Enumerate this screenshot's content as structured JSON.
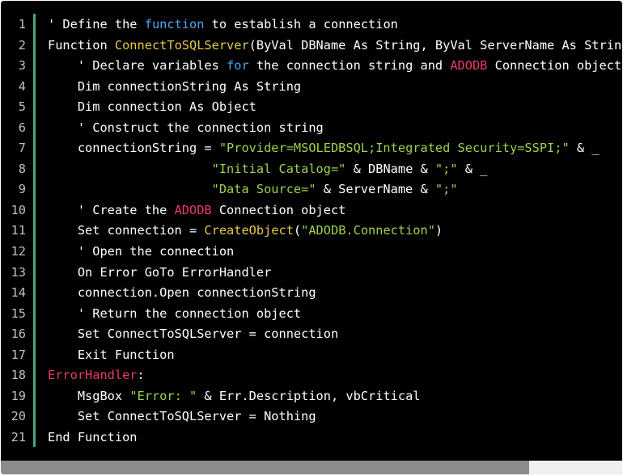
{
  "editor": {
    "language": "VBA",
    "colors": {
      "background": "#000000",
      "text": "#ffffff",
      "line_number": "#c0c0c0",
      "gutter_border": "#48a87b",
      "keyword": "#4aa5f0",
      "function_name": "#e6c84a",
      "string": "#9dd34c",
      "identifier": "#ee3a6a",
      "scroll_thumb": "#8c8c8c",
      "scroll_track": "#f0f0f0"
    },
    "lines": [
      {
        "number": "1",
        "tokens": [
          {
            "t": "plain",
            "v": "' Define the "
          },
          {
            "t": "kw",
            "v": "function"
          },
          {
            "t": "plain",
            "v": " to establish a connection"
          }
        ]
      },
      {
        "number": "2",
        "tokens": [
          {
            "t": "plain",
            "v": "Function "
          },
          {
            "t": "fn",
            "v": "ConnectToSQLServer"
          },
          {
            "t": "plain",
            "v": "(ByVal DBName As String, ByVal ServerName As String)"
          }
        ]
      },
      {
        "number": "3",
        "tokens": [
          {
            "t": "plain",
            "v": "    ' Declare variables "
          },
          {
            "t": "kw",
            "v": "for"
          },
          {
            "t": "plain",
            "v": " the connection string and "
          },
          {
            "t": "ident",
            "v": "ADODB"
          },
          {
            "t": "plain",
            "v": " Connection object"
          }
        ]
      },
      {
        "number": "4",
        "tokens": [
          {
            "t": "plain",
            "v": "    Dim connectionString As String"
          }
        ]
      },
      {
        "number": "5",
        "tokens": [
          {
            "t": "plain",
            "v": "    Dim connection As Object"
          }
        ]
      },
      {
        "number": "6",
        "tokens": [
          {
            "t": "plain",
            "v": "    ' Construct the connection string"
          }
        ]
      },
      {
        "number": "7",
        "tokens": [
          {
            "t": "plain",
            "v": "    connectionString = "
          },
          {
            "t": "str",
            "v": "\"Provider=MSOLEDBSQL;Integrated Security=SSPI;\""
          },
          {
            "t": "plain",
            "v": " & _"
          }
        ]
      },
      {
        "number": "8",
        "tokens": [
          {
            "t": "plain",
            "v": "                      "
          },
          {
            "t": "str",
            "v": "\"Initial Catalog=\""
          },
          {
            "t": "plain",
            "v": " & DBName & "
          },
          {
            "t": "str",
            "v": "\";\""
          },
          {
            "t": "plain",
            "v": " & _"
          }
        ]
      },
      {
        "number": "9",
        "tokens": [
          {
            "t": "plain",
            "v": "                      "
          },
          {
            "t": "str",
            "v": "\"Data Source=\""
          },
          {
            "t": "plain",
            "v": " & ServerName & "
          },
          {
            "t": "str",
            "v": "\";\""
          }
        ]
      },
      {
        "number": "10",
        "tokens": [
          {
            "t": "plain",
            "v": "    ' Create the "
          },
          {
            "t": "ident",
            "v": "ADODB"
          },
          {
            "t": "plain",
            "v": " Connection object"
          }
        ]
      },
      {
        "number": "11",
        "tokens": [
          {
            "t": "plain",
            "v": "    Set connection = "
          },
          {
            "t": "fn",
            "v": "CreateObject"
          },
          {
            "t": "plain",
            "v": "("
          },
          {
            "t": "str",
            "v": "\"ADODB.Connection\""
          },
          {
            "t": "plain",
            "v": ")"
          }
        ]
      },
      {
        "number": "12",
        "tokens": [
          {
            "t": "plain",
            "v": "    ' Open the connection"
          }
        ]
      },
      {
        "number": "13",
        "tokens": [
          {
            "t": "plain",
            "v": "    On Error GoTo ErrorHandler"
          }
        ]
      },
      {
        "number": "14",
        "tokens": [
          {
            "t": "plain",
            "v": "    connection.Open connectionString"
          }
        ]
      },
      {
        "number": "15",
        "tokens": [
          {
            "t": "plain",
            "v": "    ' Return the connection object"
          }
        ]
      },
      {
        "number": "16",
        "tokens": [
          {
            "t": "plain",
            "v": "    Set ConnectToSQLServer = connection"
          }
        ]
      },
      {
        "number": "17",
        "tokens": [
          {
            "t": "plain",
            "v": "    Exit Function"
          }
        ]
      },
      {
        "number": "18",
        "tokens": [
          {
            "t": "ident",
            "v": "ErrorHandler"
          },
          {
            "t": "plain",
            "v": ":"
          }
        ]
      },
      {
        "number": "19",
        "tokens": [
          {
            "t": "plain",
            "v": "    MsgBox "
          },
          {
            "t": "str",
            "v": "\"Error: \""
          },
          {
            "t": "plain",
            "v": " & Err.Description, vbCritical"
          }
        ]
      },
      {
        "number": "20",
        "tokens": [
          {
            "t": "plain",
            "v": "    Set ConnectToSQLServer = Nothing"
          }
        ]
      },
      {
        "number": "21",
        "tokens": [
          {
            "t": "plain",
            "v": "End Function"
          }
        ]
      }
    ]
  },
  "scrollbar": {
    "horizontal_position": 0.0,
    "visible_fraction": 0.85
  }
}
